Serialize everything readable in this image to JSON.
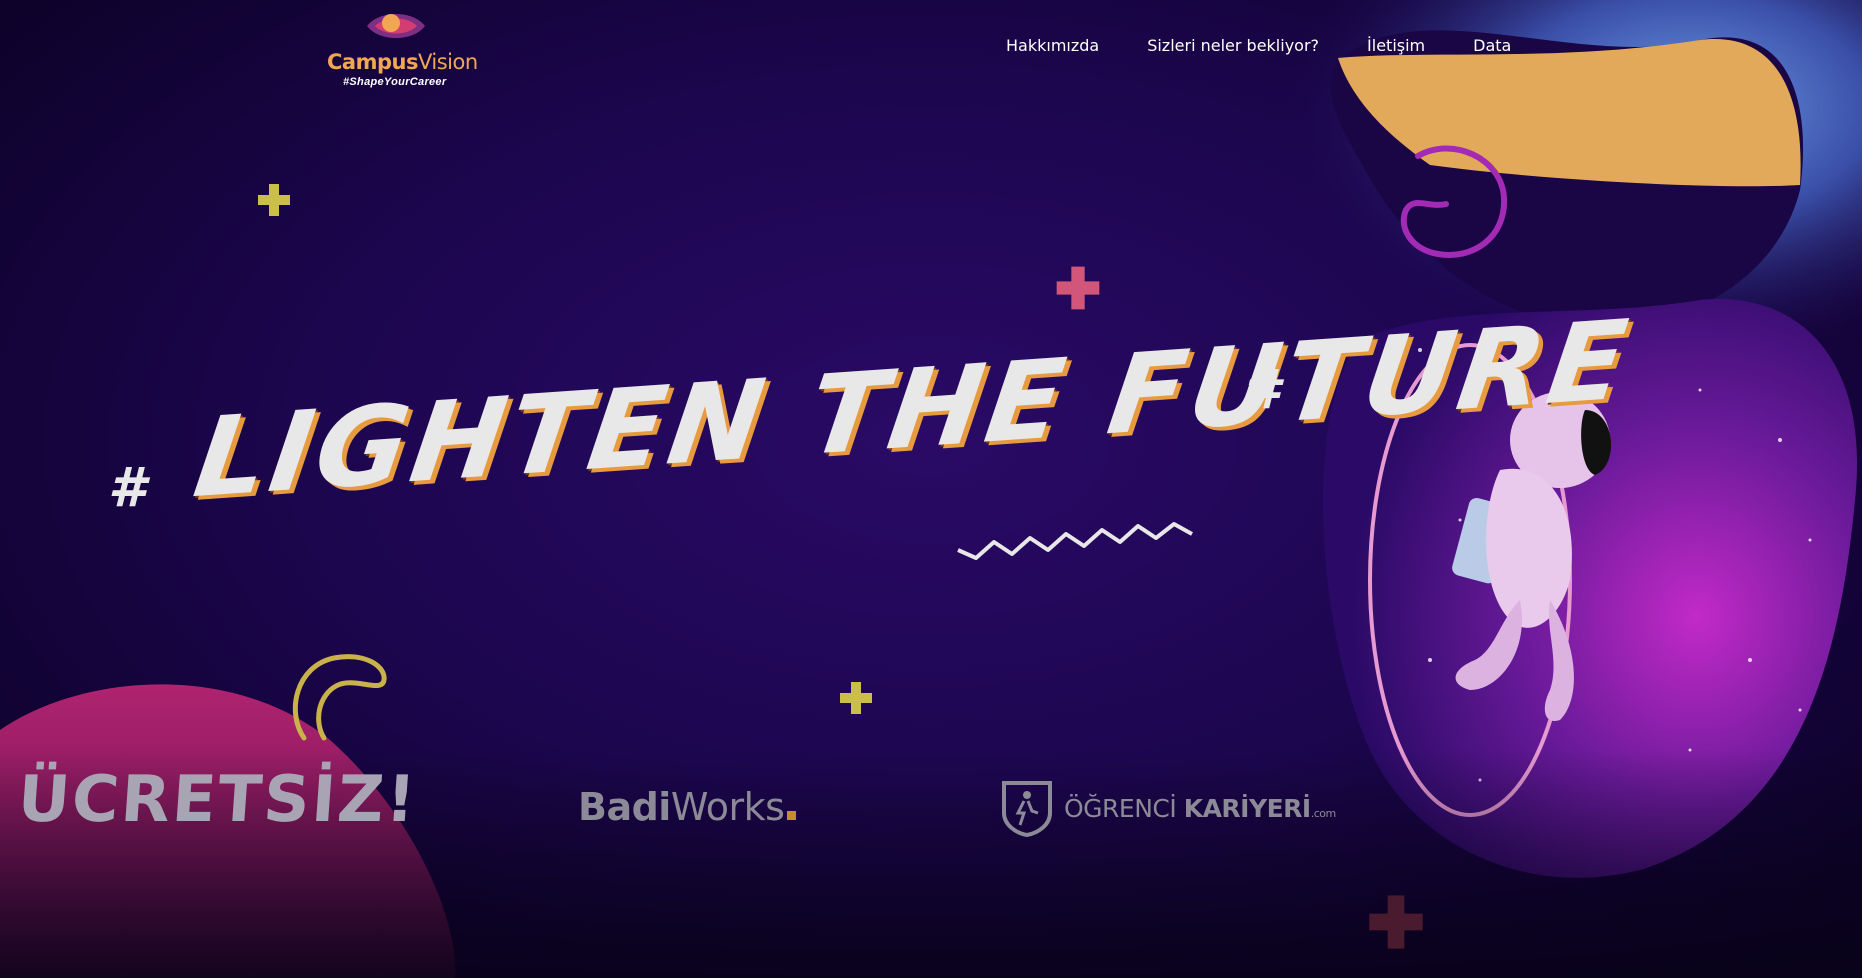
{
  "brand": {
    "name_part1": "Campus",
    "name_part2": "Vision",
    "tagline": "#ShapeYourCareer"
  },
  "nav": {
    "items": [
      {
        "label": "Hakkımızda"
      },
      {
        "label": "Sizleri neler bekliyor?"
      },
      {
        "label": "İletişim"
      },
      {
        "label": "Data"
      }
    ]
  },
  "hero": {
    "hash_left": "#",
    "headline": "LIGHTEN THE FUTURE",
    "hash_right": "#"
  },
  "badge": {
    "text": "ÜCRETSİZ!"
  },
  "sponsors": {
    "badiworks": {
      "part1": "Badi",
      "part2": "Works"
    },
    "ogrenci": {
      "part1": "ÖĞRENCİ ",
      "part2": "KARİYERİ",
      "suffix": ".com"
    }
  },
  "colors": {
    "background": "#1d0650",
    "accent_orange": "#f2a654",
    "blob_pink": "#b0236f",
    "blob_yellow": "#e3a95b",
    "plus_yellow": "#c9bf4a",
    "plus_pink": "#d2567a"
  }
}
